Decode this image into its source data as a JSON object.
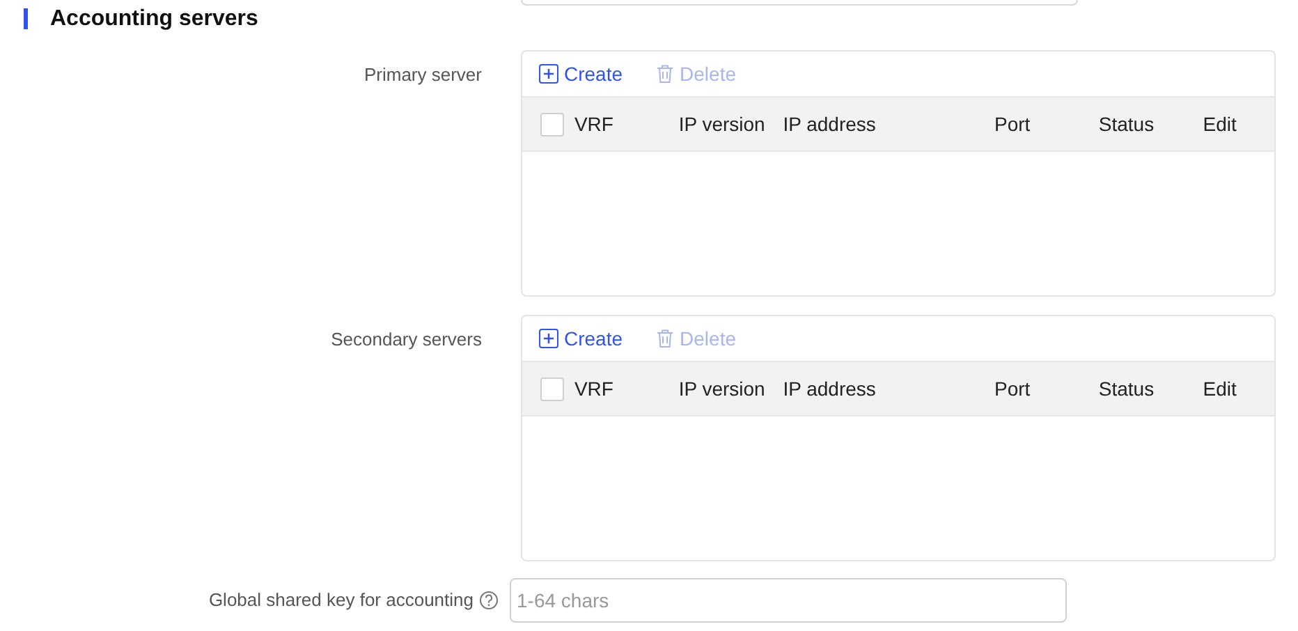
{
  "section": {
    "title": "Accounting servers"
  },
  "server_tables": [
    {
      "label": "Primary server",
      "toolbar": [
        {
          "kind": "create",
          "label": "Create",
          "disabled": false
        },
        {
          "kind": "delete",
          "label": "Delete",
          "disabled": true
        }
      ],
      "select_all": {
        "checked": false
      },
      "columns": [
        "VRF",
        "IP version",
        "IP address",
        "Port",
        "Status",
        "Edit"
      ]
    },
    {
      "label": "Secondary servers",
      "toolbar": [
        {
          "kind": "create",
          "label": "Create",
          "disabled": false
        },
        {
          "kind": "delete",
          "label": "Delete",
          "disabled": true
        }
      ],
      "select_all": {
        "checked": false
      },
      "columns": [
        "VRF",
        "IP version",
        "IP address",
        "Port",
        "Status",
        "Edit"
      ]
    }
  ],
  "shared_key": {
    "label": "Global shared key for accounting",
    "placeholder": "1-64 chars"
  }
}
